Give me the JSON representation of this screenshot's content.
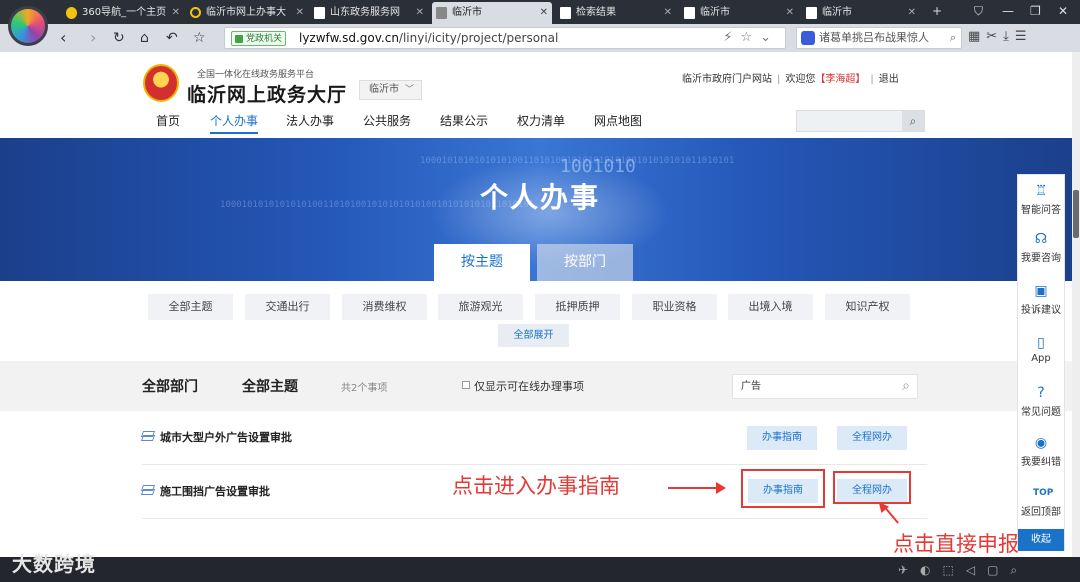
{
  "browser": {
    "tabs": [
      {
        "label": "360导航_一个主页"
      },
      {
        "label": "临沂市网上办事大"
      },
      {
        "label": "山东政务服务网"
      },
      {
        "label": "临沂市"
      },
      {
        "label": "检索结果"
      },
      {
        "label": "临沂市"
      },
      {
        "label": "临沂市"
      }
    ],
    "url_badge": "党政机关",
    "url_host": "lyzwfw.sd.gov.cn",
    "url_path": "/linyi/icity/project/personal",
    "search_placeholder": "诸葛单挑吕布战果惊人"
  },
  "header": {
    "subtitle": "全国一体化在线政务服务平台",
    "title": "临沂网上政务大厅",
    "city_select": "临沂市",
    "portal_link": "临沂市政府门户网站",
    "welcome": "欢迎您",
    "user": "【李海超】",
    "logout": "退出"
  },
  "nav": {
    "items": [
      "首页",
      "个人办事",
      "法人办事",
      "公共服务",
      "结果公示",
      "权力清单",
      "网点地图"
    ]
  },
  "banner": {
    "title": "个人办事",
    "tab_topic": "按主题",
    "tab_dept": "按部门",
    "binary_text": "1000101010101010100110101001010101010100101010101011010101",
    "big_binary": "1001010"
  },
  "topics": {
    "items": [
      "全部主题",
      "交通出行",
      "消费维权",
      "旅游观光",
      "抵押质押",
      "职业资格",
      "出境入境",
      "知识产权"
    ],
    "expand": "全部展开"
  },
  "filter": {
    "dept": "全部部门",
    "topic": "全部主题",
    "count": "共2个事项",
    "online_only": "仅显示可在线办理事项",
    "search_value": "广告"
  },
  "results": [
    {
      "name": "城市大型户外广告设置审批",
      "guide": "办事指南",
      "online": "全程网办"
    },
    {
      "name": "施工围挡广告设置审批",
      "guide": "办事指南",
      "online": "全程网办"
    }
  ],
  "annotations": {
    "guide_hint": "点击进入办事指南",
    "apply_hint": "点击直接申报"
  },
  "sidefloat": {
    "items": [
      "智能问答",
      "我要咨询",
      "投诉建议",
      "App",
      "常见问题",
      "我要纠错",
      "返回顶部"
    ],
    "collapse": "收起"
  },
  "watermark": "大数跨境",
  "colors": {
    "accent": "#1a73c9",
    "banner": "#2457b8",
    "annotation": "#e53935"
  }
}
